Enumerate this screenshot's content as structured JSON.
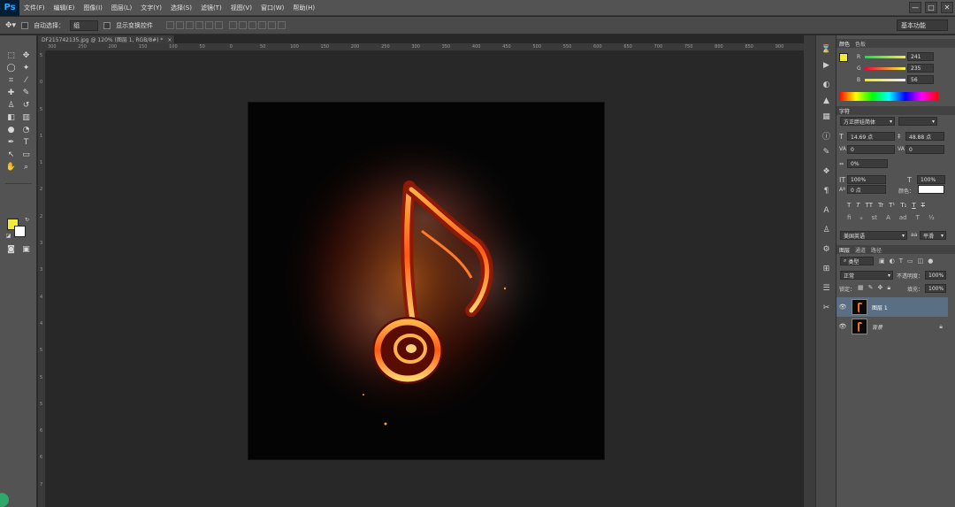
{
  "app": {
    "logo": "Ps"
  },
  "menubar": {
    "items": [
      "文件(F)",
      "编辑(E)",
      "图像(I)",
      "图层(L)",
      "文字(Y)",
      "选择(S)",
      "滤镜(T)",
      "视图(V)",
      "窗口(W)",
      "帮助(H)"
    ],
    "controls": [
      "—",
      "□",
      "✕"
    ]
  },
  "options": {
    "auto_select_label": "自动选择：",
    "auto_select_value": "组",
    "transform_label": "显示变换控件",
    "workspace": "基本功能"
  },
  "document": {
    "tab_title": "DF215742135.jpg @ 120% (图层 1, RGB/8#) *",
    "ruler_h_labels": [
      "300",
      "250",
      "200",
      "150",
      "100",
      "50",
      "0",
      "50",
      "100",
      "150",
      "200",
      "250",
      "300",
      "350",
      "400",
      "450",
      "500",
      "550",
      "600",
      "650",
      "700",
      "750",
      "800",
      "850",
      "900"
    ],
    "ruler_v_labels": [
      "5",
      "0",
      "5",
      "1",
      "1",
      "2",
      "2",
      "3",
      "3",
      "4",
      "4",
      "5",
      "5",
      "5",
      "6",
      "6",
      "7"
    ]
  },
  "panels": {
    "color": {
      "tabs": [
        "颜色",
        "色板"
      ],
      "r_label": "R",
      "r_value": "241",
      "g_label": "G",
      "g_value": "235",
      "b_label": "B",
      "b_value": "56",
      "fg_color": "#f1eb38"
    },
    "character": {
      "tab": "字符",
      "font_family": "方正胖娃简体",
      "font_size": "14.69 点",
      "leading": "48.88 点",
      "kerning": "0",
      "tracking": "0",
      "scale_percent": "0%",
      "vertical_scale": "100%",
      "horizontal_scale": "100%",
      "baseline": "0 点",
      "color_label": "颜色：",
      "type_styles": [
        "T",
        "T",
        "TT",
        "Tr",
        "T¹",
        "T₁",
        "T",
        "T"
      ],
      "language": "美国英语",
      "anti_alias": "平滑"
    },
    "layers": {
      "tabs": [
        "图层",
        "通道",
        "路径"
      ],
      "kind": "类型",
      "blend_mode": "正常",
      "opacity_label": "不透明度：",
      "opacity": "100%",
      "lock_label": "锁定：",
      "fill_label": "填充：",
      "fill": "100%",
      "items": [
        {
          "name": "图层 1",
          "selected": true
        },
        {
          "name": "背景",
          "selected": false,
          "locked": true
        }
      ]
    }
  },
  "colors": {
    "accent_fg": "#f1eb38",
    "bg": "#ffffff",
    "canvas": "#040404",
    "selected_layer": "#5a6e84"
  }
}
